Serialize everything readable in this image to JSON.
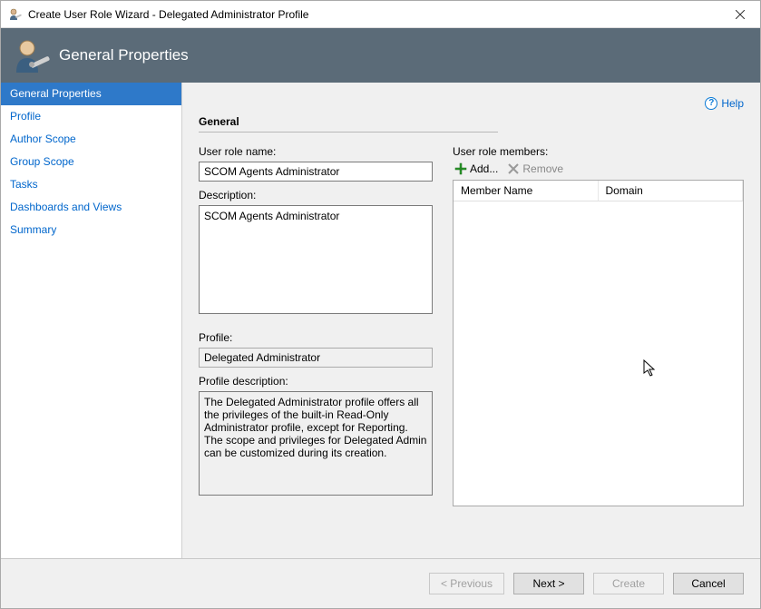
{
  "window": {
    "title": "Create User Role Wizard - Delegated Administrator Profile",
    "close_icon": "close"
  },
  "banner": {
    "title": "General Properties"
  },
  "sidebar": {
    "items": [
      {
        "label": "General Properties",
        "active": true
      },
      {
        "label": "Profile",
        "active": false
      },
      {
        "label": "Author Scope",
        "active": false
      },
      {
        "label": "Group Scope",
        "active": false
      },
      {
        "label": "Tasks",
        "active": false
      },
      {
        "label": "Dashboards and Views",
        "active": false
      },
      {
        "label": "Summary",
        "active": false
      }
    ]
  },
  "help": {
    "label": "Help"
  },
  "general": {
    "heading": "General",
    "role_name_label": "User role name:",
    "role_name_value": "SCOM Agents Administrator",
    "description_label": "Description:",
    "description_value": "SCOM Agents Administrator",
    "profile_label": "Profile:",
    "profile_value": "Delegated Administrator",
    "profile_desc_label": "Profile description:",
    "profile_desc_value": "The Delegated Administrator profile offers all the privileges of the built-in Read-Only Administrator profile, except for Reporting. The scope and privileges for Delegated Admin can be customized during its creation."
  },
  "members": {
    "label": "User role members:",
    "add_label": "Add...",
    "remove_label": "Remove",
    "columns": {
      "member": "Member Name",
      "domain": "Domain"
    },
    "rows": []
  },
  "footer": {
    "previous": "< Previous",
    "next": "Next >",
    "create": "Create",
    "cancel": "Cancel"
  }
}
